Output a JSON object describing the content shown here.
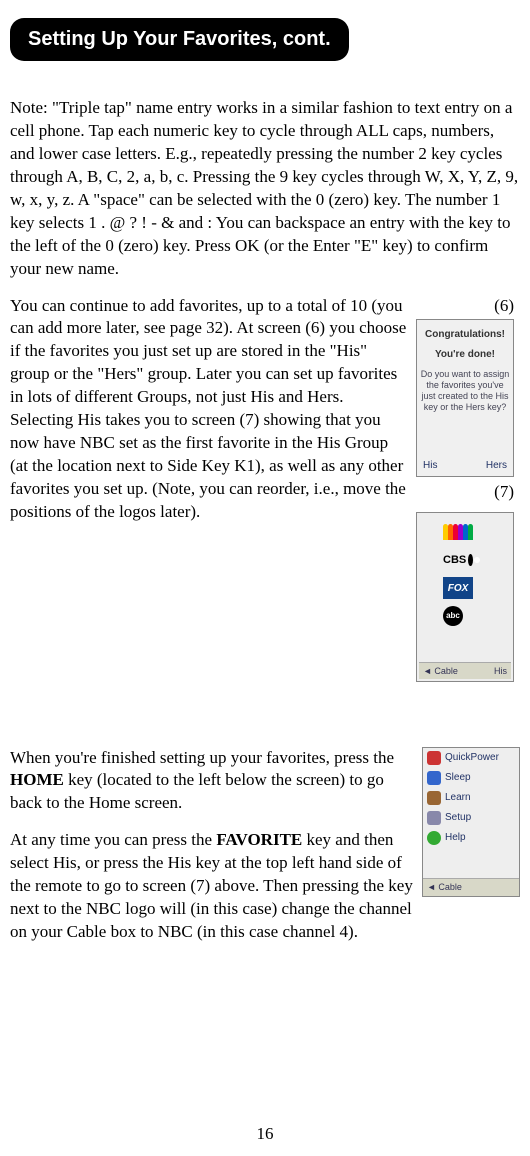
{
  "header": "Setting Up Your Favorites, cont.",
  "para1": "Note: \"Triple tap\" name entry works in a similar fashion to text entry on a cell phone. Tap each numeric key to cycle through ALL caps, numbers, and lower case letters. E.g., repeatedly pressing the number 2 key cycles through A, B, C, 2, a, b, c. Pressing the 9 key cycles through W, X, Y, Z, 9, w, x, y, z. A \"space\" can be selected with the 0 (zero) key. The number 1 key selects 1 . @ ? ! - & and :  You can backspace an entry with the key to the left of the 0 (zero) key. Press OK (or the Enter \"E\" key) to confirm your new name.",
  "label6": "(6)",
  "label7": "(7)",
  "para2": "You can continue to add favorites, up to a total of 10 (you can add more later, see page 32). At screen (6) you choose if the favorites you just set up are stored in the \"His\" group or the \"Hers\" group. Later you can set up favorites in lots of different Groups, not just His and Hers. Selecting His takes you to screen (7) showing that you now have NBC set as the first favorite in the His Group (at the location next to Side Key K1), as well as any other favorites you set up. (Note, you can reorder, i.e., move the positions of the logos later).",
  "para3a": "When you're finished setting up your favorites, press the ",
  "para3b": "HOME",
  "para3c": " key (located to the left below the screen) to go back to the Home screen.",
  "para4a": "At any time you can press the ",
  "para4b": "FAVORITE",
  "para4c": " key and then select His, or press the His key at the top left hand side of the remote to go to screen (7) above. Then pressing the key next to the NBC logo will (in this case) change the channel on your Cable box to NBC (in this case channel 4).",
  "pagenum": "16",
  "shot6": {
    "line1": "Congratulations!",
    "line2": "You're done!",
    "line3": "Do you want to assign the favorites you've just created to the His key or the Hers key?",
    "sk_left": "His",
    "sk_right": "Hers"
  },
  "shot7": {
    "cbs": "CBS",
    "fox": "FOX",
    "abc": "abc",
    "bar_left": "Cable",
    "bar_right": "His"
  },
  "shot8": {
    "items": [
      "QuickPower",
      "Sleep",
      "Learn",
      "Setup",
      "Help"
    ],
    "bar_left": "Cable"
  }
}
